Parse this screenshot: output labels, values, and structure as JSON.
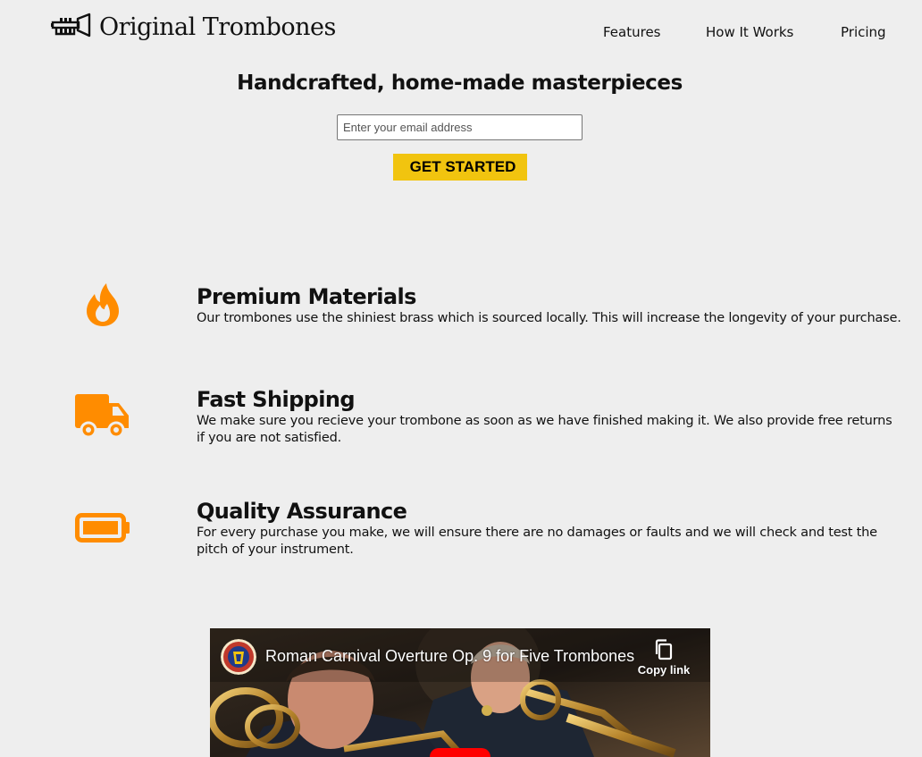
{
  "brand": {
    "name": "Original Trombones",
    "logo_icon": "trumpet-icon"
  },
  "nav": {
    "items": [
      {
        "label": "Features"
      },
      {
        "label": "How It Works"
      },
      {
        "label": "Pricing"
      }
    ]
  },
  "hero": {
    "title": "Handcrafted, home-made masterpieces",
    "email_placeholder": "Enter your email address",
    "email_value": "",
    "cta_label": "GET STARTED"
  },
  "features": [
    {
      "icon": "fire-icon",
      "title": "Premium Materials",
      "description": "Our trombones use the shiniest brass which is sourced locally. This will increase the longevity of your purchase."
    },
    {
      "icon": "truck-icon",
      "title": "Fast Shipping",
      "description": "We make sure you recieve your trombone as soon as we have finished making it. We also provide free returns if you are not satisfied."
    },
    {
      "icon": "battery-icon",
      "title": "Quality Assurance",
      "description": "For every purchase you make, we will ensure there are no damages or faults and we will check and test the pitch of your instrument."
    }
  ],
  "video": {
    "title": "Roman Carnival Overture Op. 9 for Five Trombones",
    "copy_link_label": "Copy link",
    "channel_icon": "channel-logo-icon",
    "copy_icon": "copy-icon"
  },
  "colors": {
    "background": "#eeeeee",
    "accent_orange": "#ff8c00",
    "cta_yellow": "#f1c40f",
    "youtube_red": "#ff0000"
  }
}
